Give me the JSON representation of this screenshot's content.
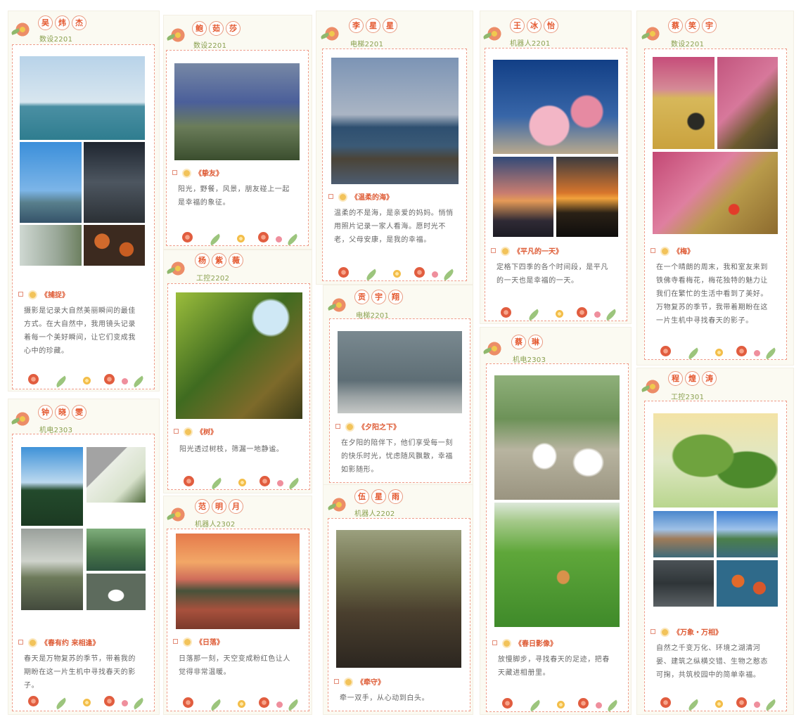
{
  "panels": [
    {
      "name_chars": [
        "吴",
        "炜",
        "杰"
      ],
      "class": "数设2201",
      "title": "《捕捉》",
      "desc": "摄影是记录大自然美丽瞬间的最佳方式。在大自然中，我用镜头记录着每一个美好瞬间，让它们变成我心中的珍藏。"
    },
    {
      "name_chars": [
        "钟",
        "晓",
        "雯"
      ],
      "class": "机电2303",
      "title": "《春有约 来相逢》",
      "desc": "春天是万物复苏的季节，带着我的期盼在这一片生机中寻找春天的影子。"
    },
    {
      "name_chars": [
        "鲍",
        "茹",
        "莎"
      ],
      "class": "数设2201",
      "title": "《挚友》",
      "desc": "阳光，野餐，风景，朋友碰上一起是幸福的象征。"
    },
    {
      "name_chars": [
        "杨",
        "紫",
        "薇"
      ],
      "class": "工控2202",
      "title": "《树》",
      "desc": "阳光透过树枝，筛漏一地静谧。"
    },
    {
      "name_chars": [
        "范",
        "明",
        "月"
      ],
      "class": "机器人2302",
      "title": "《日落》",
      "desc": "日落那一刻，天空变成粉红色让人觉得非常温暖。"
    },
    {
      "name_chars": [
        "李",
        "星",
        "星"
      ],
      "class": "电梯2201",
      "title": "《温柔的海》",
      "desc": "温柔的不是海，是亲爱的妈妈。悄悄用照片记录一家人看海。愿时光不老，父母安康，是我的幸福。"
    },
    {
      "name_chars": [
        "贡",
        "宇",
        "翔"
      ],
      "class": "电梯2201",
      "title": "《夕阳之下》",
      "desc": "在夕阳的陪伴下，他们享受每一刻的快乐时光，忧虑随风飘散，幸福如影随形。"
    },
    {
      "name_chars": [
        "伍",
        "星",
        "雨"
      ],
      "class": "机器人2202",
      "title": "《牵守》",
      "desc": "牵一双手，从心动到白头。"
    },
    {
      "name_chars": [
        "王",
        "冰",
        "怡"
      ],
      "class": "机器人2201",
      "title": "《平凡的一天》",
      "desc": "定格下四季的各个时间段，是平凡的一天也是幸福的一天。"
    },
    {
      "name_chars": [
        "蔡",
        "琳"
      ],
      "class": "机电2303",
      "title": "《春日影像》",
      "desc": "放慢脚步，寻找春天的足迹，把春天藏进相册里。"
    },
    {
      "name_chars": [
        "蔡",
        "笑",
        "宇"
      ],
      "class": "数设2201",
      "title": "《梅》",
      "desc": "在一个晴朗的周末，我和室友来到铁佛寺看梅花，梅花独特的魅力让我们在繁忙的生活中看到了美好。万物复苏的季节，我带着期盼在这一片生机中寻找春天的影子。"
    },
    {
      "name_chars": [
        "程",
        "煌",
        "涛"
      ],
      "class": "工控2301",
      "title": "《万象・万相》",
      "desc": "自然之千变万化、环境之湖清河晏、建筑之纵横交错、生物之憨态可掬，共筑校园中的简单幸福。"
    }
  ]
}
